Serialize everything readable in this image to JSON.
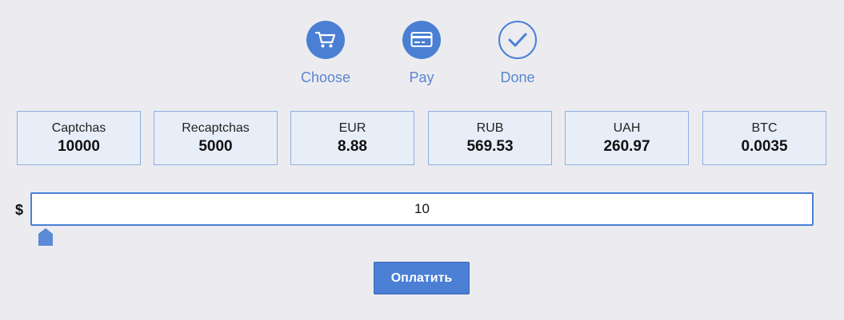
{
  "steps": [
    {
      "label": "Choose",
      "icon": "cart-icon",
      "state": "active"
    },
    {
      "label": "Pay",
      "icon": "credit-card-icon",
      "state": "active"
    },
    {
      "label": "Done",
      "icon": "checkmark-icon",
      "state": "pending"
    }
  ],
  "boxes": [
    {
      "title": "Captchas",
      "value": "10000"
    },
    {
      "title": "Recaptchas",
      "value": "5000"
    },
    {
      "title": "EUR",
      "value": "8.88"
    },
    {
      "title": "RUB",
      "value": "569.53"
    },
    {
      "title": "UAH",
      "value": "260.97"
    },
    {
      "title": "BTC",
      "value": "0.0035"
    }
  ],
  "amount": {
    "currency_symbol": "$",
    "value": "10",
    "slider_position": 0.01
  },
  "pay_button": {
    "label": "Оплатить"
  },
  "colors": {
    "accent": "#4a7fd4",
    "background": "#ececf0",
    "box_background": "#e8eef8",
    "box_border": "#8eaee0"
  }
}
